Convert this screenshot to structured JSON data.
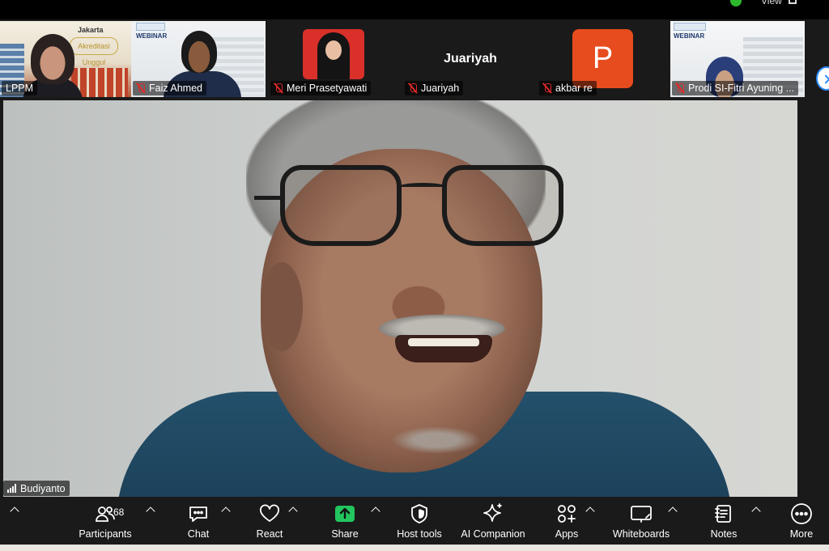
{
  "top_bar": {
    "view_label": "View"
  },
  "participants_strip": [
    {
      "name": "LPPM",
      "muted": false,
      "banner_title": "Jakarta",
      "banner_badge": "Akreditasi Unggul"
    },
    {
      "name": "Faiz Ahmed",
      "muted": true,
      "banner_title": "WEBINAR"
    },
    {
      "name": "Meri Prasetyawati",
      "muted": true
    },
    {
      "name": "Juariyah",
      "muted": true,
      "center_name": "Juariyah"
    },
    {
      "name": "akbar re",
      "muted": true,
      "avatar_letter": "P"
    },
    {
      "name": "Prodi SI-Fitri Ayuning ...",
      "muted": true,
      "banner_title": "WEBINAR"
    }
  ],
  "active_speaker": {
    "name": "Budiyanto"
  },
  "toolbar": {
    "participants": {
      "label": "Participants",
      "count": "68"
    },
    "chat": {
      "label": "Chat"
    },
    "react": {
      "label": "React"
    },
    "share": {
      "label": "Share"
    },
    "host_tools": {
      "label": "Host tools"
    },
    "ai_companion": {
      "label": "AI Companion"
    },
    "apps": {
      "label": "Apps"
    },
    "whiteboards": {
      "label": "Whiteboards"
    },
    "notes": {
      "label": "Notes"
    },
    "more": {
      "label": "More"
    }
  },
  "colors": {
    "share_green": "#22c55e",
    "mute_red": "#e02828",
    "avatar_orange": "#e64c1e",
    "accent_blue": "#2d8cff"
  }
}
